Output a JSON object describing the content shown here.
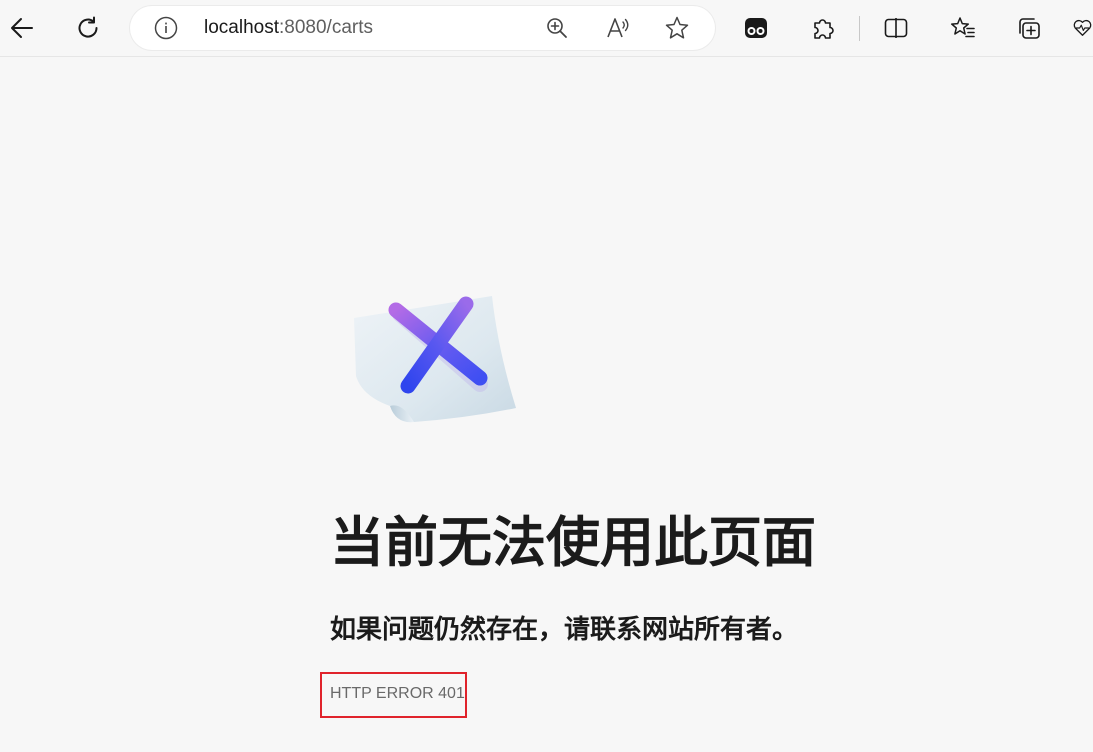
{
  "browser": {
    "url_host": "localhost",
    "url_path": ":8080/carts",
    "icons": {
      "back": "back-arrow-icon",
      "refresh": "refresh-icon",
      "site_info": "info-icon",
      "zoom": "zoom-in-icon",
      "read_aloud": "read-aloud-icon",
      "favorite": "star-icon",
      "extension_game": "gamepad-icon",
      "extensions": "puzzle-icon",
      "split_screen": "split-screen-icon",
      "favorites": "favorites-icon",
      "collections": "collections-icon",
      "performance": "heart-pulse-icon"
    }
  },
  "error_page": {
    "title": "当前无法使用此页面",
    "subtitle": "如果问题仍然存在，请联系网站所有者。",
    "error_code": "HTTP ERROR 401",
    "highlight_color": "#e0232b"
  }
}
